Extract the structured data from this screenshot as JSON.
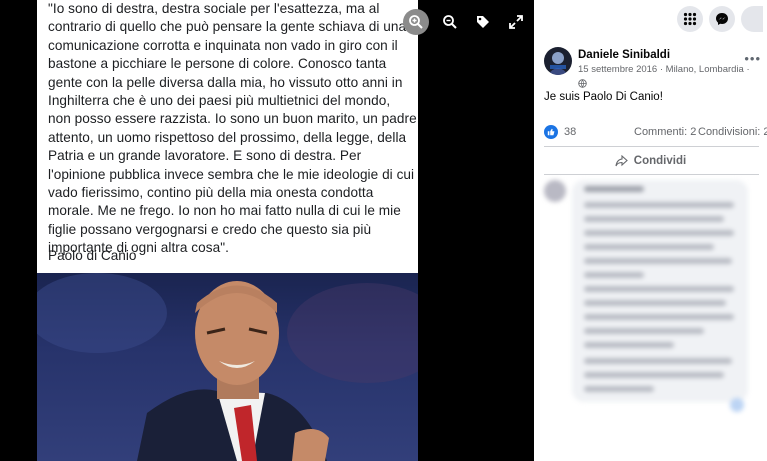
{
  "quote_lines": [
    "\"Io sono di destra, destra sociale per l'esattezza, ma al",
    "contrario di quello che può pensare la gente schiava di una",
    "comunicazione corrotta e inquinata non vado in giro con il",
    "bastone a picchiare le persone di colore. Conosco tanta",
    "gente con la pelle diversa dalla mia, ho vissuto otto anni in",
    "Inghilterra che è uno dei paesi più multietnici del mondo,",
    "non posso essere razzista. Io sono un buon marito, un padre",
    "attento, un uomo rispettoso del prossimo, della legge, della",
    "Patria e un grande lavoratore. E sono di destra. Per",
    "l'opinione pubblica invece sembra che le mie ideologie di cui",
    "vado fierissimo, contino più della mia onesta condotta",
    "morale. Me ne frego. Io non ho mai fatto nulla di cui le mie",
    "figlie possano vergognarsi e credo che questo sia più",
    "importante di ogni altra cosa\"."
  ],
  "quote_author": "Paolo di Canio",
  "viewer_tools": [
    "zoom-in-icon",
    "zoom-out-icon",
    "tag-icon",
    "fullscreen-icon"
  ],
  "topbar_icons": [
    "menu-grid-icon",
    "messenger-icon",
    "account-icon"
  ],
  "post": {
    "author": "Daniele Sinibaldi",
    "meta": "15 settembre 2016 · Milano, Lombardia ·",
    "text": "Je suis Paolo Di Canio!",
    "likes": "38",
    "comments": "Commenti: 2",
    "shares": "Condivisioni: 2",
    "share_label": "Condividi"
  },
  "colors": {
    "like_blue": "#1b74e4",
    "text_gray": "#65676b"
  }
}
